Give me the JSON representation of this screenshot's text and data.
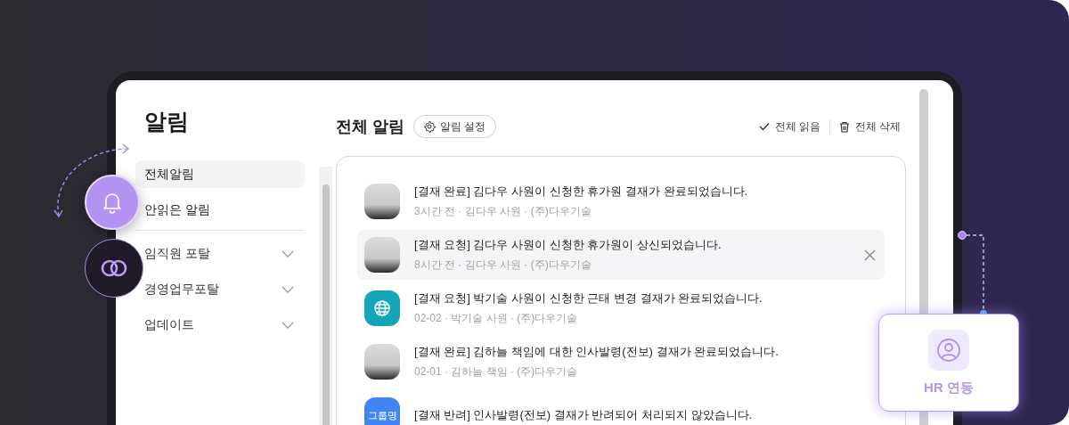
{
  "sidebar": {
    "title": "알림",
    "items": [
      {
        "label": "전체알림",
        "kind": "item",
        "selected": true
      },
      {
        "label": "안읽은 알림",
        "kind": "item",
        "selected": false
      },
      {
        "label": "임직원 포탈",
        "kind": "group",
        "selected": false,
        "expanded": false
      },
      {
        "label": "경영업무포탈",
        "kind": "group",
        "selected": false,
        "expanded": false
      },
      {
        "label": "업데이트",
        "kind": "group",
        "selected": false,
        "expanded": false
      }
    ]
  },
  "main": {
    "title": "전체 알림",
    "settings_button": "알림 설정",
    "actions": [
      {
        "label": "전체 읽음",
        "kind": "check"
      },
      {
        "label": "전체 삭제",
        "kind": "trash"
      }
    ],
    "notifications": [
      {
        "kind": "photo",
        "title": "[결재 완료] 김다우 사원이 신청한 휴가원 결재가 완료되었습니다.",
        "meta": "3시간 전 · 김다우 사원 · (주)다우기술",
        "highlighted": false
      },
      {
        "kind": "photo",
        "title": "[결재 요청] 김다우 사원이 신청한 휴가원이 상신되었습니다.",
        "meta": "8시간 전 · 김다우 사원 · (주)다우기술",
        "highlighted": true
      },
      {
        "kind": "globe",
        "title": "[결재 요청] 박기술 사원이 신청한 근태 변경 결재가 완료되었습니다.",
        "meta": "02-02 · 박기술 사원 · (주)다우기술",
        "highlighted": false
      },
      {
        "kind": "photo",
        "title": "[결재 완료] 김하늘 책임에 대한 인사발령(전보) 결재가 완료되었습니다.",
        "meta": "02-01 · 김하늘 책임 · (주)다우기술",
        "highlighted": false
      },
      {
        "kind": "group",
        "badge": "그룹명",
        "title": "[결재 반려] 인사발령(전보) 결재가 반려되어 처리되지 않았습니다.",
        "highlighted": false
      }
    ]
  },
  "hr_card": {
    "label": "HR 연동"
  }
}
